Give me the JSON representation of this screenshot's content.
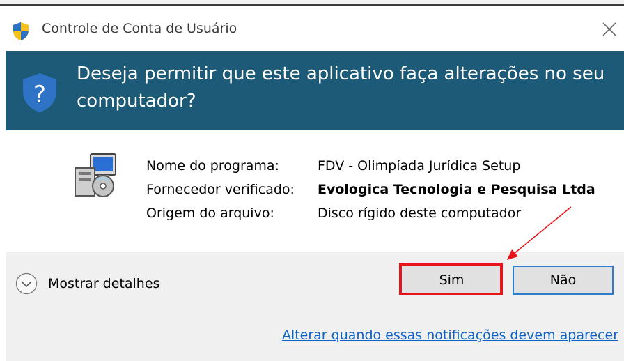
{
  "window": {
    "title": "Controle de Conta de Usuário"
  },
  "header": {
    "question": "Deseja permitir que este aplicativo faça alterações no seu computador?"
  },
  "program_info": {
    "rows": [
      {
        "label": "Nome do programa:",
        "value": "FDV - Olimpíada Jurídica Setup",
        "bold": false
      },
      {
        "label": "Fornecedor verificado:",
        "value": "Evologica Tecnologia e Pesquisa Ltda",
        "bold": true
      },
      {
        "label": "Origem do arquivo:",
        "value": "Disco rígido deste computador",
        "bold": false
      }
    ]
  },
  "footer": {
    "details_label": "Mostrar detalhes",
    "yes_label": "Sim",
    "no_label": "Não",
    "notify_link": "Alterar quando essas notificações devem aparecer"
  },
  "icons": {
    "title": "uac-shield-icon",
    "header": "question-shield-icon",
    "program": "installer-package-icon",
    "close": "close-icon",
    "details": "chevron-down-icon"
  },
  "colors": {
    "header_background": "#1c5a77",
    "footer_background": "#f0f0f0",
    "link": "#0e62c7",
    "highlight": "#e8141b",
    "default_button_border": "#2b7cd3"
  }
}
